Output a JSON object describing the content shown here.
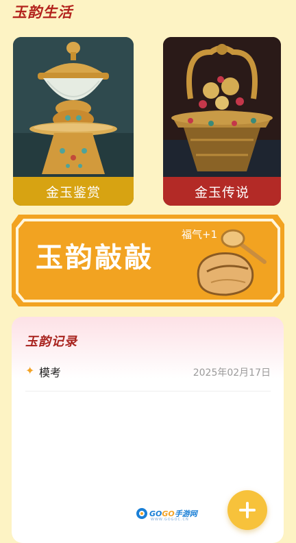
{
  "app": {
    "title": "玉韵生活"
  },
  "cards": [
    {
      "label": "金玉鉴赏",
      "image": "jade-bowl-on-gold-stand",
      "color": "#d7a312"
    },
    {
      "label": "金玉传说",
      "image": "gold-jeweled-ornament",
      "color": "#b32a26"
    }
  ],
  "banner": {
    "title": "玉韵敲敲",
    "bonus": "福气+1",
    "icon": "wooden-fish-with-mallet"
  },
  "records": {
    "title": "玉韵记录",
    "items": [
      {
        "icon": "star-icon",
        "name": "模考",
        "date": "2025年02月17日"
      }
    ]
  },
  "watermark": {
    "text_a": "GO",
    "text_b": "GO",
    "text_c": "手游网",
    "sub": "WWW.GOGOC.CN"
  },
  "fab": {
    "icon": "plus-icon"
  },
  "colors": {
    "background": "#fdf3c4",
    "accent_red": "#b3231d",
    "gold": "#d7a312",
    "banner_orange": "#f2a321",
    "fab_yellow": "#f7c23b"
  }
}
